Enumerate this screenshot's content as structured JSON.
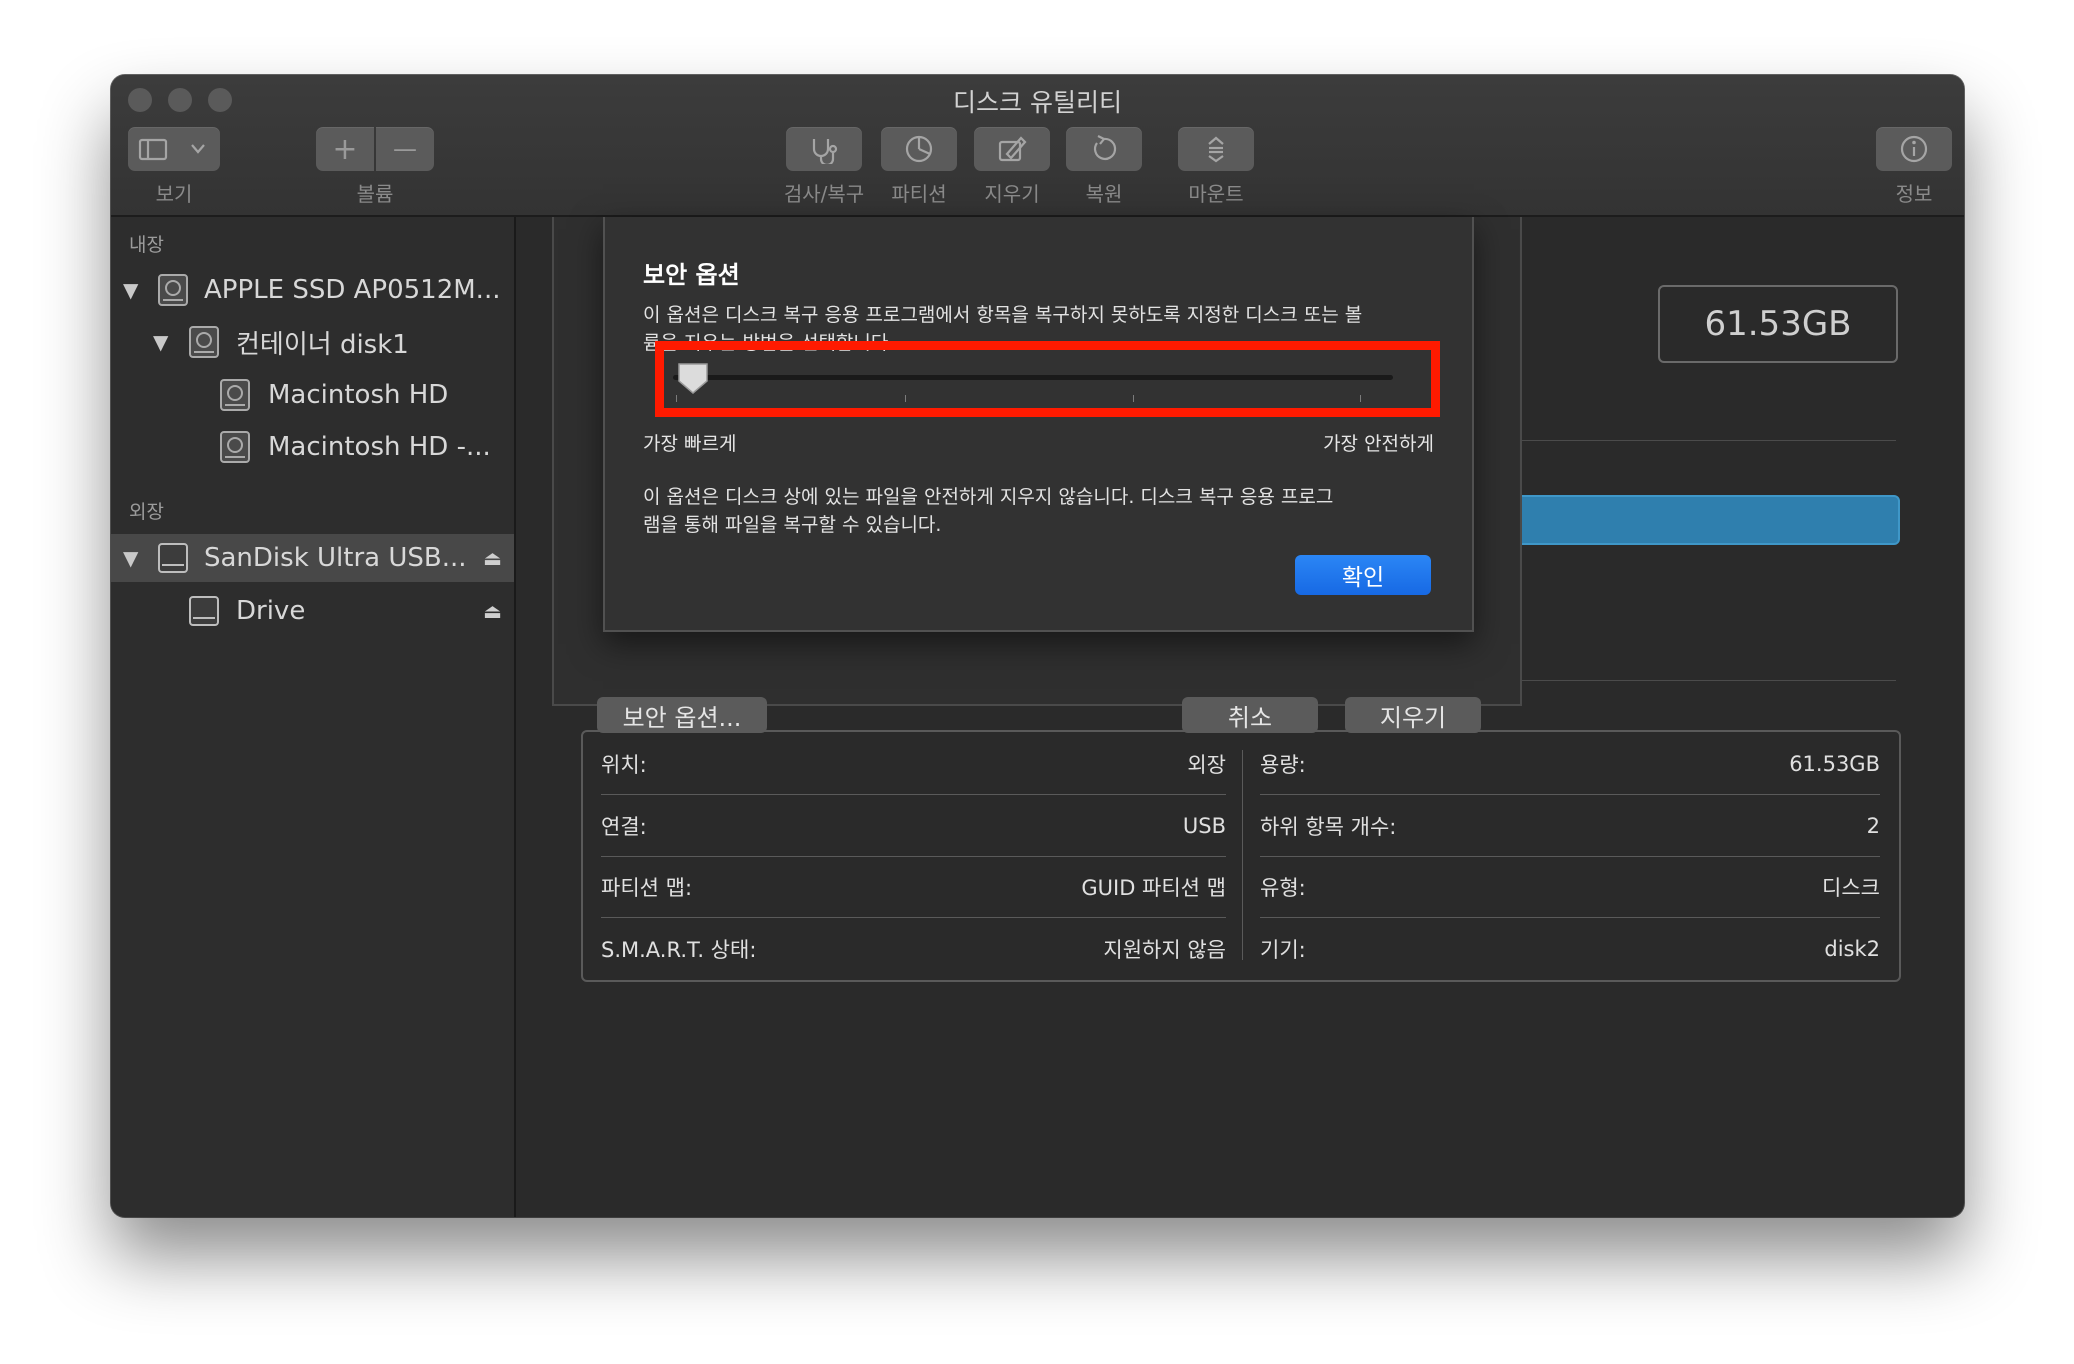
{
  "window": {
    "title": "디스크 유틸리티"
  },
  "toolbar": {
    "view_label": "보기",
    "volume_label": "볼륨",
    "first_aid_label": "검사/복구",
    "partition_label": "파티션",
    "erase_label": "지우기",
    "restore_label": "복원",
    "mount_label": "마운트",
    "info_label": "정보",
    "add_symbol": "+",
    "remove_symbol": "—"
  },
  "sidebar": {
    "internal_header": "내장",
    "external_header": "외장",
    "internal_items": [
      {
        "label": "APPLE SSD AP0512M...",
        "icon": "internal-disk-icon"
      },
      {
        "label": "컨테이너 disk1",
        "icon": "container-icon"
      },
      {
        "label": "Macintosh HD",
        "icon": "volume-icon"
      },
      {
        "label": "Macintosh HD -...",
        "icon": "volume-icon"
      }
    ],
    "external_items": [
      {
        "label": "SanDisk Ultra USB...",
        "icon": "external-disk-icon",
        "selected": true
      },
      {
        "label": "Drive",
        "icon": "external-volume-icon"
      }
    ]
  },
  "main": {
    "capacity": "61.53GB",
    "info": {
      "location_key": "위치:",
      "location_val": "외장",
      "connection_key": "연결:",
      "connection_val": "USB",
      "partition_map_key": "파티션 맵:",
      "partition_map_val": "GUID 파티션 맵",
      "smart_key": "S.M.A.R.T. 상태:",
      "smart_val": "지원하지 않음",
      "capacity_key": "용량:",
      "capacity_val": "61.53GB",
      "children_key": "하위 항목 개수:",
      "children_val": "2",
      "type_key": "유형:",
      "type_val": "디스크",
      "device_key": "기기:",
      "device_val": "disk2"
    }
  },
  "erase_sheet": {
    "security_options_button": "보안 옵션...",
    "cancel_button": "취소",
    "erase_button": "지우기"
  },
  "security_dialog": {
    "title": "보안 옵션",
    "description_line1": "이 옵션은 디스크 복구 응용 프로그램에서 항목을 복구하지 못하도록 지정한 디스크 또는 볼",
    "description_line2": "륨을 지우는 방법을 선택합니다.",
    "slider_level": 0,
    "slider_left_label": "가장 빠르게",
    "slider_right_label": "가장 안전하게",
    "detail_line1": "이 옵션은 디스크 상에 있는 파일을 안전하게 지우지 않습니다. 디스크 복구 응용 프로그",
    "detail_line2": "램을 통해 파일을 복구할 수 있습니다.",
    "ok_button": "확인",
    "highlight_color": "#ff1a00"
  }
}
